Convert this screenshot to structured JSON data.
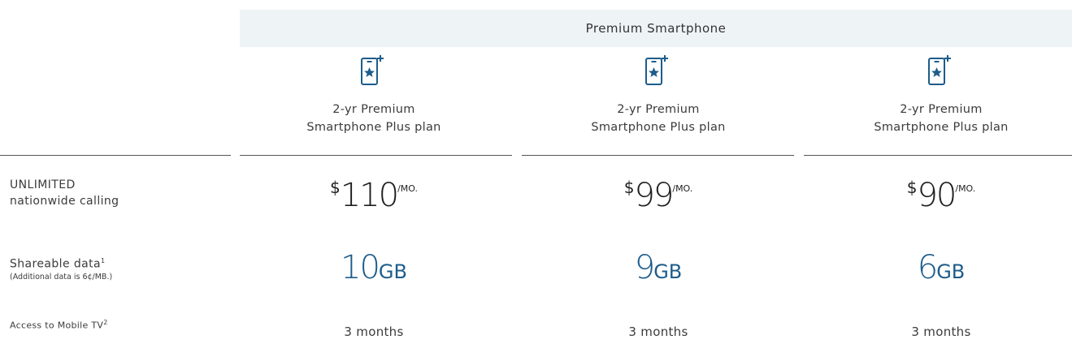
{
  "header": {
    "group_title": "Premium Smartphone"
  },
  "icons": {
    "plan_icon": "smartphone-star-plus-icon",
    "accent": "#1d5c8a"
  },
  "columns": [
    {
      "plan_name_line1": "2-yr Premium",
      "plan_name_line2": "Smartphone Plus plan",
      "price_currency": "$",
      "price_amount": "110",
      "price_period": "/MO.",
      "data_amount": "10",
      "data_unit": "GB",
      "mobile_tv": "3 months"
    },
    {
      "plan_name_line1": "2-yr Premium",
      "plan_name_line2": "Smartphone Plus plan",
      "price_currency": "$",
      "price_amount": "99",
      "price_period": "/MO.",
      "data_amount": "9",
      "data_unit": "GB",
      "mobile_tv": "3 months"
    },
    {
      "plan_name_line1": "2-yr Premium",
      "plan_name_line2": "Smartphone Plus plan",
      "price_currency": "$",
      "price_amount": "90",
      "price_period": "/MO.",
      "data_amount": "6",
      "data_unit": "GB",
      "mobile_tv": "3 months"
    }
  ],
  "rows": {
    "calling": {
      "line1": "UNLIMITED",
      "line2": "nationwide calling"
    },
    "data": {
      "line1": "Shareable data",
      "footnote": "1",
      "note": "(Additional data is 6¢/MB.)"
    },
    "mobile_tv": {
      "line1": "Access to Mobile TV",
      "footnote": "2"
    }
  }
}
